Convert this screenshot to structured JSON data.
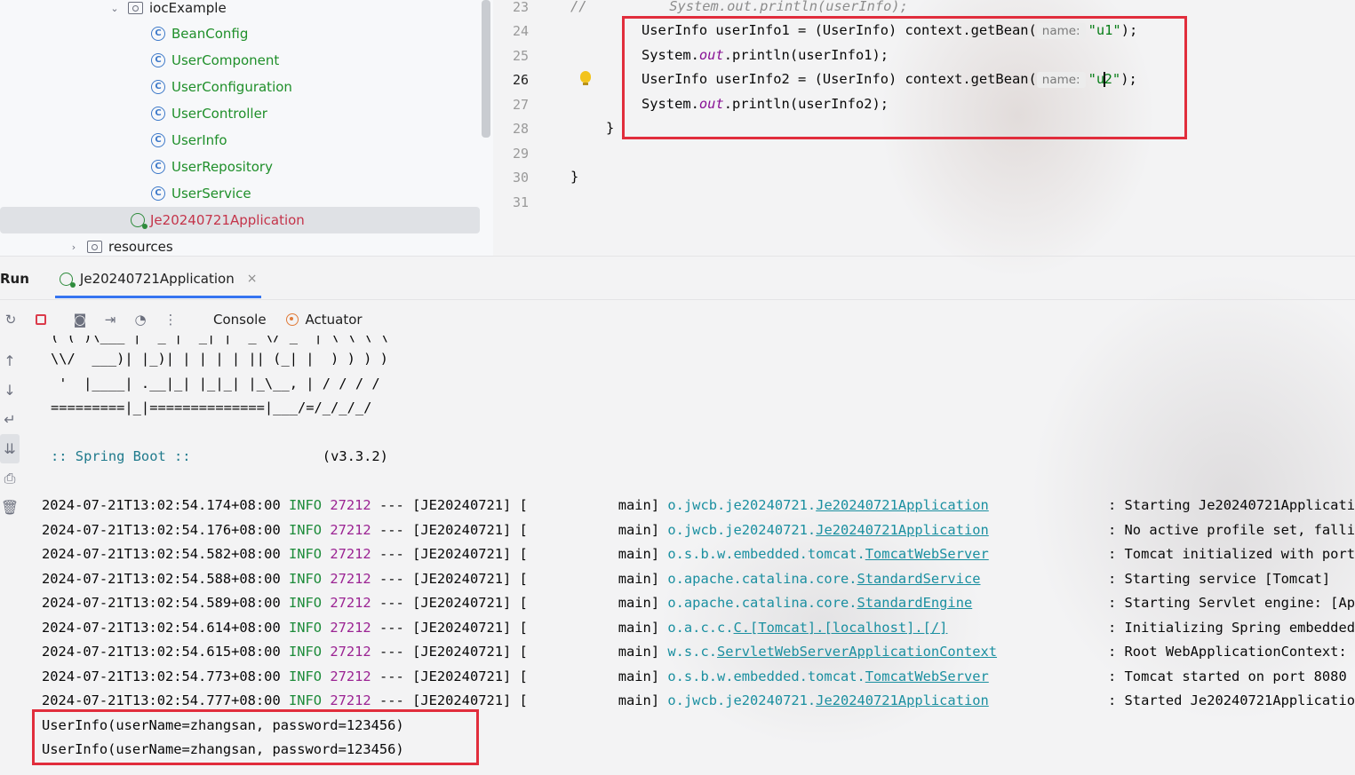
{
  "project_tree": {
    "package": "iocExample",
    "classes": [
      "BeanConfig",
      "UserComponent",
      "UserConfiguration",
      "UserController",
      "UserInfo",
      "UserRepository",
      "UserService"
    ],
    "selected_app": "Je20240721Application",
    "resources": "resources"
  },
  "editor": {
    "lines": [
      {
        "num": "23",
        "comment_prefix": "//",
        "text": "System.out.println(userInfo);"
      },
      {
        "num": "24",
        "pre": "UserInfo userInfo1 = (UserInfo) context.getBean(",
        "hint": "name:",
        "str": "\"u1\"",
        "post": ");"
      },
      {
        "num": "25",
        "pre": "System.",
        "italic": "out",
        "post": ".println(userInfo1);"
      },
      {
        "num": "26",
        "pre": "UserInfo userInfo2 = (UserInfo) context.getBean(",
        "hint": "name:",
        "str_a": "\"u",
        "str_b": "2\"",
        "post": ");"
      },
      {
        "num": "27",
        "pre": "System.",
        "italic": "out",
        "post": ".println(userInfo2);"
      },
      {
        "num": "28",
        "text": "}"
      },
      {
        "num": "29",
        "text": ""
      },
      {
        "num": "30",
        "text": "}"
      },
      {
        "num": "31",
        "text": ""
      }
    ]
  },
  "run": {
    "title": "Run",
    "tab_label": "Je20240721Application",
    "close": "×",
    "console_tab": "Console",
    "actuator_tab": "Actuator"
  },
  "console": {
    "banner": [
      "( ( )\\___ | '_ | '_| | '_ \\/ _` | \\ \\ \\ \\",
      "\\\\/  ___)| |_)| | | | | || (_| |  ) ) ) )",
      " '  |____| .__|_| |_|_| |_\\__, | / / / /",
      "=========|_|==============|___/=/_/_/_/"
    ],
    "spring_label": ":: Spring Boot ::",
    "spring_version": "(v3.3.2)",
    "logs": [
      {
        "ts": "2024-07-21T13:02:54.174+08:00",
        "level": "INFO",
        "pid": "27212",
        "sep": "---",
        "app": "[JE20240721] [",
        "thread": "main]",
        "logger_pkg": "o.jwcb.je20240721.",
        "logger_cls": "Je20240721Application",
        "msg": ": Starting Je20240721Applicati"
      },
      {
        "ts": "2024-07-21T13:02:54.176+08:00",
        "level": "INFO",
        "pid": "27212",
        "sep": "---",
        "app": "[JE20240721] [",
        "thread": "main]",
        "logger_pkg": "o.jwcb.je20240721.",
        "logger_cls": "Je20240721Application",
        "msg": ": No active profile set, falli"
      },
      {
        "ts": "2024-07-21T13:02:54.582+08:00",
        "level": "INFO",
        "pid": "27212",
        "sep": "---",
        "app": "[JE20240721] [",
        "thread": "main]",
        "logger_pkg": "o.s.b.w.embedded.tomcat.",
        "logger_cls": "TomcatWebServer",
        "msg": ": Tomcat initialized with port"
      },
      {
        "ts": "2024-07-21T13:02:54.588+08:00",
        "level": "INFO",
        "pid": "27212",
        "sep": "---",
        "app": "[JE20240721] [",
        "thread": "main]",
        "logger_pkg": "o.apache.catalina.core.",
        "logger_cls": "StandardService",
        "msg": ": Starting service [Tomcat]"
      },
      {
        "ts": "2024-07-21T13:02:54.589+08:00",
        "level": "INFO",
        "pid": "27212",
        "sep": "---",
        "app": "[JE20240721] [",
        "thread": "main]",
        "logger_pkg": "o.apache.catalina.core.",
        "logger_cls": "StandardEngine",
        "msg": ": Starting Servlet engine: [Ap"
      },
      {
        "ts": "2024-07-21T13:02:54.614+08:00",
        "level": "INFO",
        "pid": "27212",
        "sep": "---",
        "app": "[JE20240721] [",
        "thread": "main]",
        "logger_pkg": "o.a.c.c.",
        "logger_cls": "C.[Tomcat].[localhost].[/]",
        "msg": ": Initializing Spring embedded"
      },
      {
        "ts": "2024-07-21T13:02:54.615+08:00",
        "level": "INFO",
        "pid": "27212",
        "sep": "---",
        "app": "[JE20240721] [",
        "thread": "main]",
        "logger_pkg": "w.s.c.",
        "logger_cls": "ServletWebServerApplicationContext",
        "msg": ": Root WebApplicationContext:"
      },
      {
        "ts": "2024-07-21T13:02:54.773+08:00",
        "level": "INFO",
        "pid": "27212",
        "sep": "---",
        "app": "[JE20240721] [",
        "thread": "main]",
        "logger_pkg": "o.s.b.w.embedded.tomcat.",
        "logger_cls": "TomcatWebServer",
        "msg": ": Tomcat started on port 8080"
      },
      {
        "ts": "2024-07-21T13:02:54.777+08:00",
        "level": "INFO",
        "pid": "27212",
        "sep": "---",
        "app": "[JE20240721] [",
        "thread": "main]",
        "logger_pkg": "o.jwcb.je20240721.",
        "logger_cls": "Je20240721Application",
        "msg": ": Started Je20240721Applicatio"
      }
    ],
    "output": [
      "UserInfo(userName=zhangsan, password=123456)",
      "UserInfo(userName=zhangsan, password=123456)"
    ]
  },
  "colors": {
    "highlight_box": "#e12d3c",
    "string": "#067d17",
    "info_level": "#1d8b3a",
    "pid": "#9b2393",
    "logger": "#1a8fa0"
  }
}
